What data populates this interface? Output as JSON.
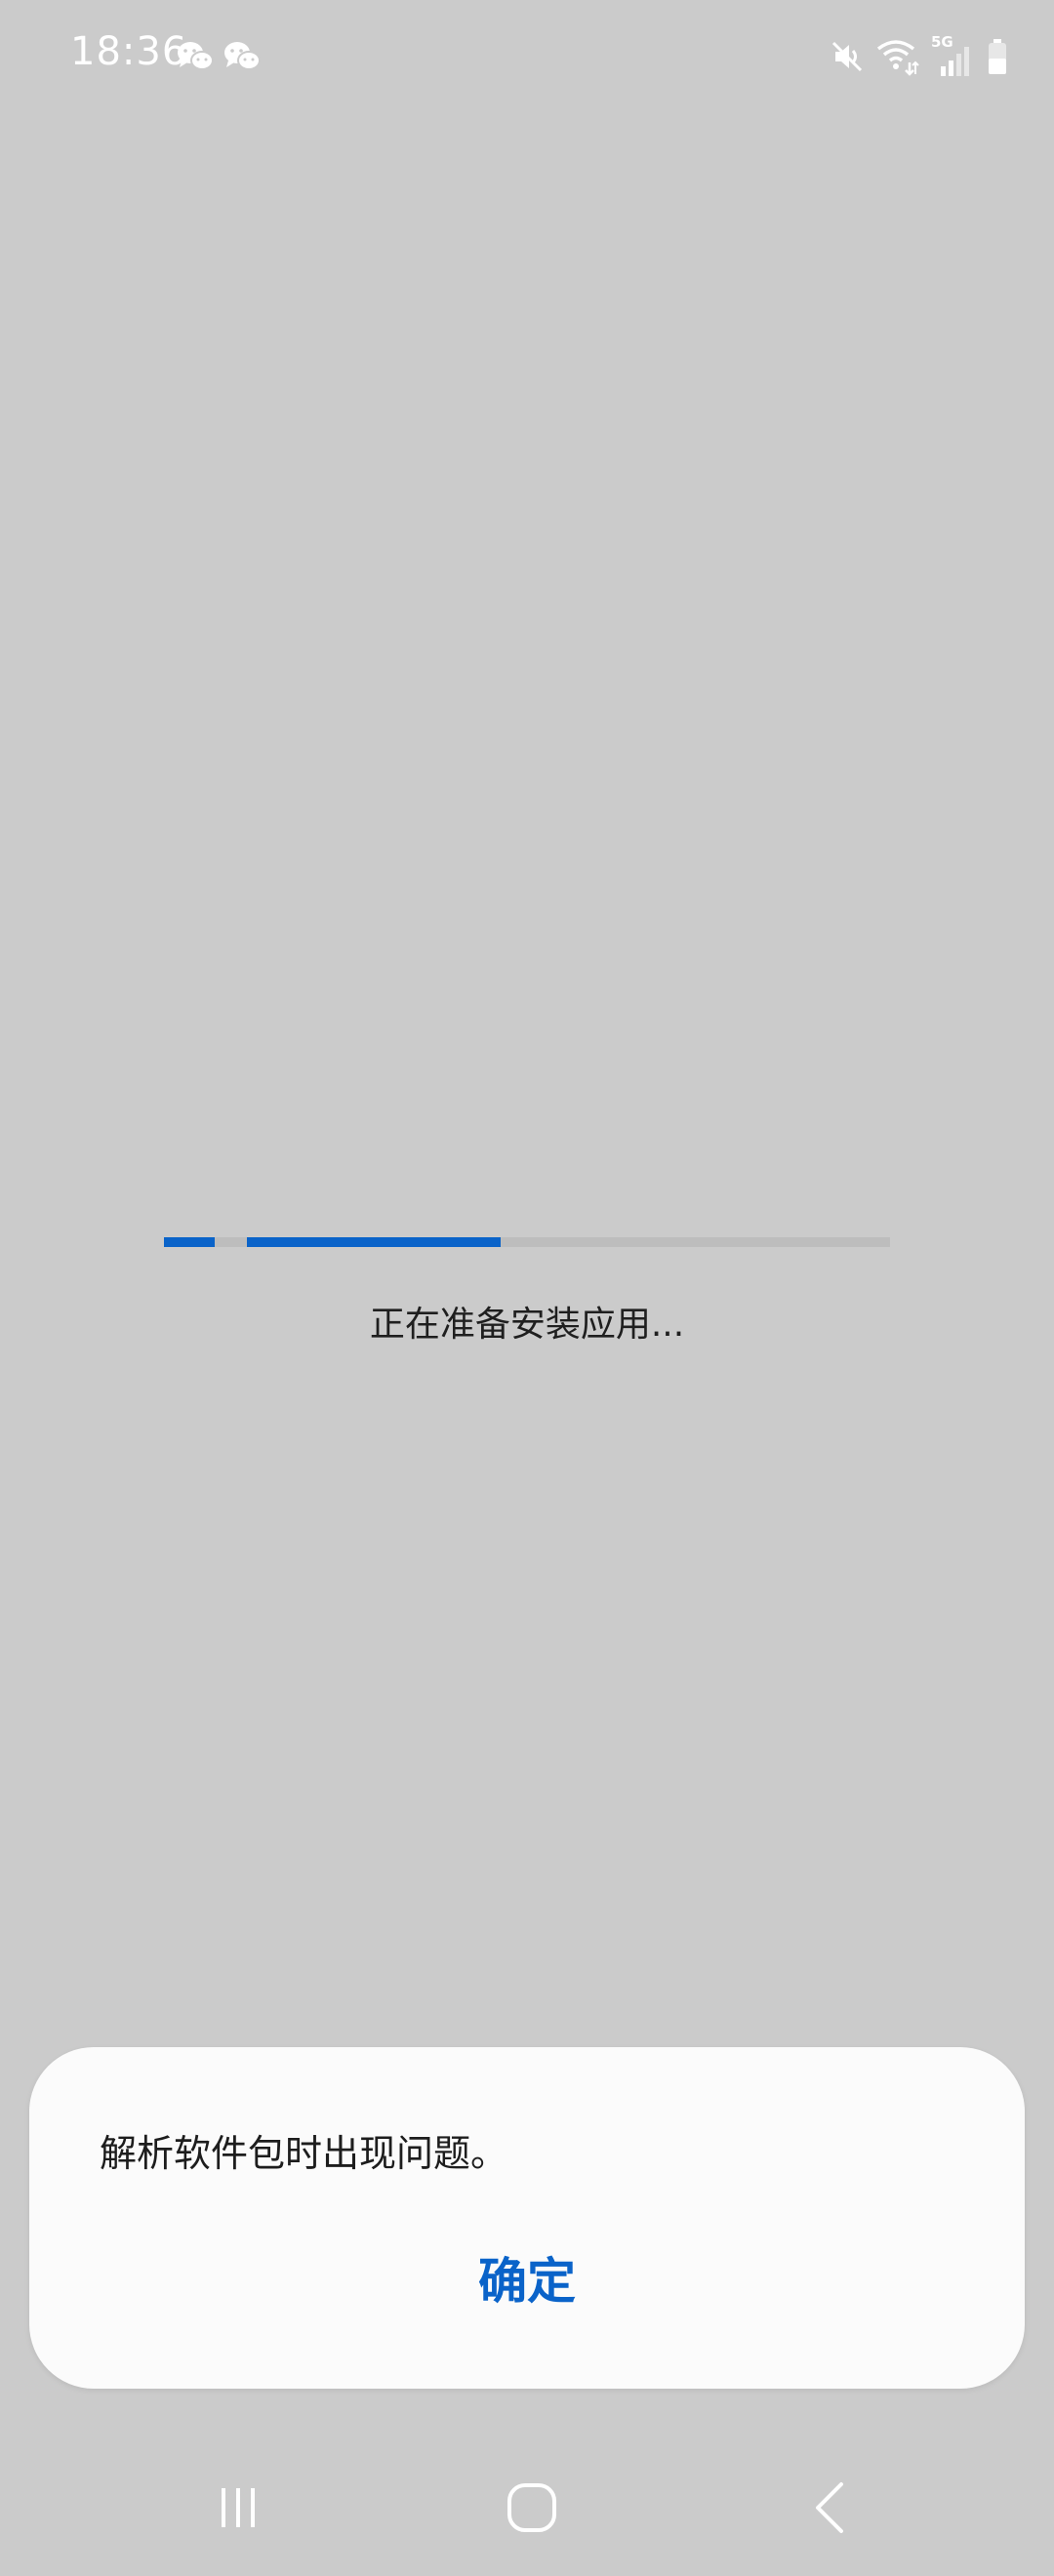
{
  "status_bar": {
    "time": "18:36",
    "notification_icons": [
      "wechat-icon",
      "wechat-icon"
    ],
    "network_label": "5G",
    "icons": [
      "mute-icon",
      "wifi-icon",
      "signal-icon",
      "battery-icon"
    ],
    "icon_color": "#ffffff"
  },
  "installer": {
    "status_text": "正在准备安装应用...",
    "progress_fraction": 0.35,
    "accent_color": "#0a63c9"
  },
  "dialog": {
    "message": "解析软件包时出现问题。",
    "ok_label": "确定"
  },
  "nav_bar": {
    "buttons": [
      "recent-apps-icon",
      "home-icon",
      "back-icon"
    ]
  }
}
